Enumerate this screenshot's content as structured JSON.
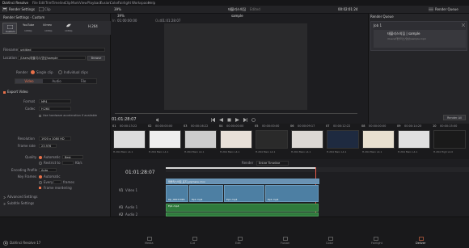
{
  "menu": {
    "items": [
      "DaVinci Resolve",
      "File",
      "Edit",
      "Trim",
      "Timeline",
      "Clip",
      "Mark",
      "View",
      "Playback",
      "Fusion",
      "Color",
      "Fairlight",
      "Workspace",
      "Help"
    ]
  },
  "toolbar": {
    "render_settings": "Render Settings",
    "clip_label": "Clip",
    "zoom": "39%",
    "project": "태블리스의집",
    "edited": "Edited",
    "timecode": "00:02:01:24",
    "render_queue": "Render Queue"
  },
  "render_panel": {
    "title": "Render Settings - Custom",
    "presets": [
      "Custom",
      "YouTube",
      "Vimeo",
      "Twitter",
      "H.264"
    ],
    "preset_sub": [
      "",
      "1080p",
      "1080p",
      "1080p",
      ""
    ],
    "filename_label": "Filename",
    "filename_value": "untitled",
    "location_label": "Location",
    "location_value": "/Users/태블리스/영상/sample",
    "browse": "Browse",
    "render_label": "Render",
    "single_clip": "Single clip",
    "individual_clips": "Individual clips",
    "tabs": [
      "Video",
      "Audio",
      "File"
    ],
    "export_video": "Export Video",
    "format_label": "Format",
    "format_value": "MP4",
    "codec_label": "Codec",
    "codec_value": "H.264",
    "hw_accel": "Use hardware acceleration if available",
    "resolution_label": "Resolution",
    "resolution_value": "1920 x 1080 HD",
    "framerate_label": "Frame rate",
    "framerate_value": "23.976",
    "quality_label": "Quality",
    "quality_auto": "Automatic",
    "quality_value": "Best",
    "restrict_to": "Restrict to",
    "kbs": "Kb/s",
    "encoding_label": "Encoding Profile",
    "encoding_value": "Auto",
    "keyframes_label": "Key Frames",
    "keyframes_auto": "Automatic",
    "every": "Every",
    "frames": "frames",
    "frame_reorder": "Frame reordering",
    "advanced": "Advanced Settings",
    "subtitle": "Subtitle Settings",
    "add_to_queue": "Add to Render Queue"
  },
  "viewer": {
    "clip_name": "sample",
    "tc_in": "01:00:00:00",
    "tc_out": "01:01:28:07",
    "timecode": "01:01:28:07",
    "in_label": "In",
    "out_label": "Out"
  },
  "queue": {
    "title": "Render Queue",
    "job": "Job 1",
    "job_title": "태블리스의집 | sample",
    "job_path": "/Users/태블리스/영상/sample.mp4",
    "render_all": "Render All"
  },
  "thumbs": [
    {
      "num": "01",
      "tc": "00:00:13:22",
      "codec": "H.264 Main L4.1"
    },
    {
      "num": "02",
      "tc": "00:00:00:00",
      "codec": "H.264 Main L4.1"
    },
    {
      "num": "03",
      "tc": "00:00:16:22",
      "codec": "H.264 Main L4.1"
    },
    {
      "num": "04",
      "tc": "00:00:00:00",
      "codec": "H.264 Main L4.1"
    },
    {
      "num": "05",
      "tc": "00:00:00:00",
      "codec": "H.264 Main L4.1"
    },
    {
      "num": "06",
      "tc": "00:00:09:17",
      "codec": "H.264 Main L4.1"
    },
    {
      "num": "07",
      "tc": "00:00:12:22",
      "codec": "H.264 Main L4.1"
    },
    {
      "num": "08",
      "tc": "00:00:00:00",
      "codec": "H.264 Main L4.1"
    },
    {
      "num": "09",
      "tc": "00:00:14:20",
      "codec": "H.264 Main L4.1"
    },
    {
      "num": "10",
      "tc": "00:00:15:00",
      "codec": "H.264 High L4.0"
    }
  ],
  "timeline": {
    "render_label": "Render",
    "render_value": "Entire Timeline",
    "timecode": "01:01:28:07",
    "v1": "V1",
    "video1": "Video 1",
    "a1": "A1",
    "audio1": "Audio 1",
    "a2": "A2",
    "audio2": "Audio 2",
    "clip_title": "태블리스의집_표지_pipmenu.mov",
    "clip_labels": [
      "DJI_0003.MP4",
      "Ep1.mp4",
      "Ep1.mp4",
      "Ep1.mp4"
    ],
    "audio_label": "Ep1.mp4"
  },
  "pages": [
    "Media",
    "Cut",
    "Edit",
    "Fusion",
    "Color",
    "Fairlight",
    "Deliver"
  ],
  "app": {
    "name": "DaVinci Resolve 17"
  },
  "colors": {
    "accent": "#e8714a",
    "video_clip": "#4d7fa3",
    "audio_clip": "#2f7a3c"
  }
}
